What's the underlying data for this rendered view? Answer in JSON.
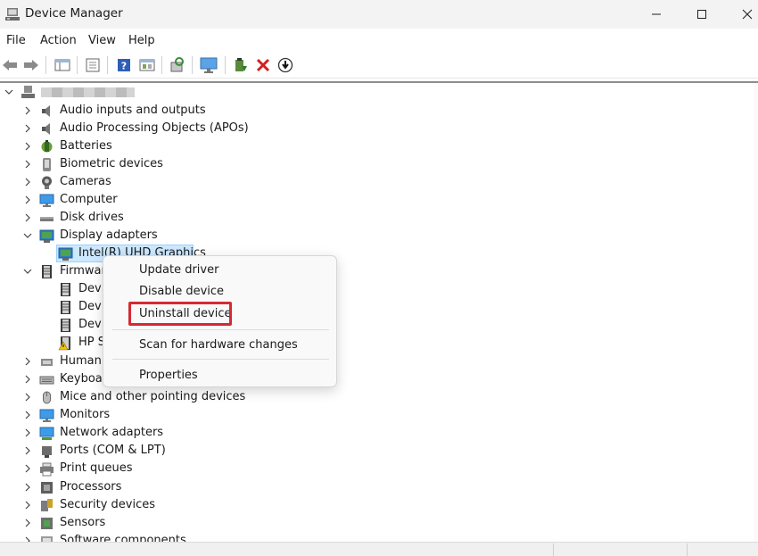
{
  "window": {
    "title": "Device Manager",
    "controls": {
      "minimize": "—",
      "maximize": "☐",
      "close": "✕"
    }
  },
  "menu": [
    "File",
    "Action",
    "View",
    "Help"
  ],
  "toolbar": {
    "icons": [
      "back-arrow-icon",
      "forward-arrow-icon",
      "show-hide-tree-icon",
      "properties-icon",
      "help-icon",
      "view-icon",
      "scan-hardware-icon",
      "monitor-icon",
      "update-driver-icon",
      "uninstall-icon",
      "disable-device-icon"
    ]
  },
  "tree": {
    "root_label": "",
    "categories": [
      {
        "label": "Audio inputs and outputs",
        "icon": "speaker-icon"
      },
      {
        "label": "Audio Processing Objects (APOs)",
        "icon": "speaker-icon"
      },
      {
        "label": "Batteries",
        "icon": "battery-icon"
      },
      {
        "label": "Biometric devices",
        "icon": "fingerprint-icon"
      },
      {
        "label": "Cameras",
        "icon": "camera-icon"
      },
      {
        "label": "Computer",
        "icon": "computer-icon"
      },
      {
        "label": "Disk drives",
        "icon": "disk-icon"
      },
      {
        "label": "Display adapters",
        "icon": "display-adapter-icon"
      },
      {
        "label": "Intel(R) UHD Graphics",
        "icon": "display-adapter-icon"
      },
      {
        "label": "Firmware",
        "icon": "firmware-icon"
      },
      {
        "label": "Devi",
        "icon": "firmware-icon"
      },
      {
        "label": "Devi",
        "icon": "firmware-icon"
      },
      {
        "label": "Devi",
        "icon": "firmware-icon"
      },
      {
        "label": "HP S",
        "icon": "warning-firmware-icon"
      },
      {
        "label": "Human",
        "icon": "hid-icon"
      },
      {
        "label": "Keyboar",
        "icon": "keyboard-icon"
      },
      {
        "label": "Mice and other pointing devices",
        "icon": "mouse-icon"
      },
      {
        "label": "Monitors",
        "icon": "monitor-icon"
      },
      {
        "label": "Network adapters",
        "icon": "network-icon"
      },
      {
        "label": "Ports (COM & LPT)",
        "icon": "port-icon"
      },
      {
        "label": "Print queues",
        "icon": "printer-icon"
      },
      {
        "label": "Processors",
        "icon": "processor-icon"
      },
      {
        "label": "Security devices",
        "icon": "security-icon"
      },
      {
        "label": "Sensors",
        "icon": "sensor-icon"
      },
      {
        "label": "Software components",
        "icon": "software-icon"
      }
    ]
  },
  "context_menu": {
    "items": [
      "Update driver",
      "Disable device",
      "Uninstall device",
      "Scan for hardware changes",
      "Properties"
    ],
    "highlighted": "Uninstall device"
  },
  "colors": {
    "selection": "#cce8ff",
    "highlight_box": "#d42a33",
    "titlebar": "#f3f3f3"
  }
}
